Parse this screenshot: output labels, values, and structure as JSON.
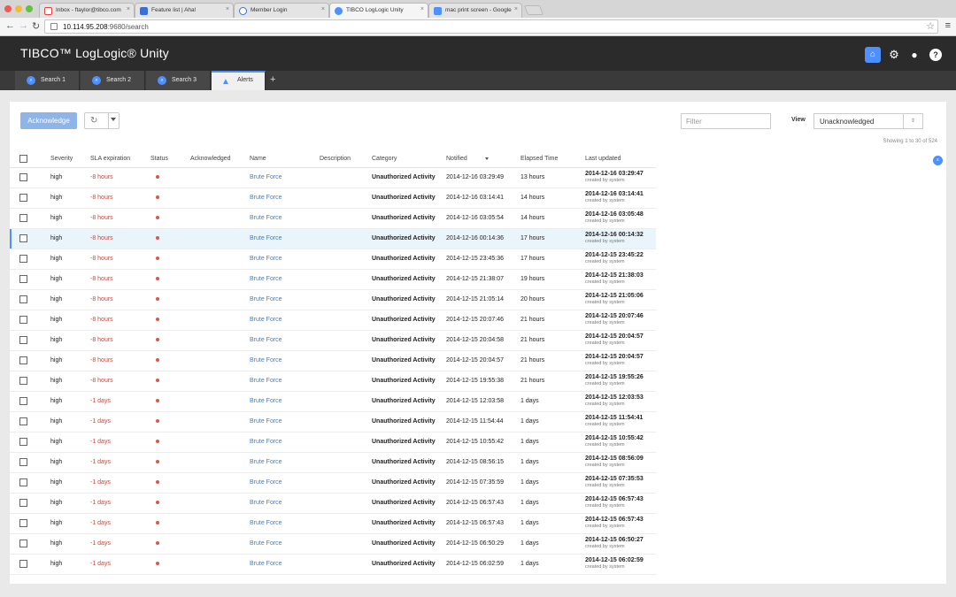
{
  "browser": {
    "tabs": [
      {
        "label": "Inbox - ftaylor@tibco.com"
      },
      {
        "label": "Feature list | Aha!"
      },
      {
        "label": "Member Login"
      },
      {
        "label": "TIBCO LogLogic Unity"
      },
      {
        "label": "mac print screen - Google"
      }
    ],
    "url_host": "10.114.95.208",
    "url_path": ":9680/search"
  },
  "app": {
    "logo": "TIBCO™ LogLogic® Unity",
    "tabs": [
      {
        "label": "Search 1"
      },
      {
        "label": "Search 2"
      },
      {
        "label": "Search 3"
      },
      {
        "label": "Alerts"
      }
    ],
    "add_tab": "+"
  },
  "toolbar": {
    "acknowledge": "Acknowledge",
    "filter_placeholder": "Filter",
    "view_label": "View",
    "view_value": "Unacknowledged",
    "showing": "Showing 1 to 30 of 524"
  },
  "table": {
    "headers": {
      "severity": "Severity",
      "sla": "SLA expiration",
      "status": "Status",
      "ack": "Acknowledged",
      "name": "Name",
      "desc": "Description",
      "category": "Category",
      "notified": "Notified",
      "elapsed": "Elapsed Time",
      "updated": "Last updated"
    },
    "rows": [
      {
        "severity": "high",
        "sla": "-8 hours",
        "name": "Brute Force",
        "category": "Unauthorized Activity",
        "notified": "2014-12-16 03:29:49",
        "elapsed": "13 hours",
        "updated": "2014-12-16 03:29:47",
        "by": "created by system"
      },
      {
        "severity": "high",
        "sla": "-8 hours",
        "name": "Brute Force",
        "category": "Unauthorized Activity",
        "notified": "2014-12-16 03:14:41",
        "elapsed": "14 hours",
        "updated": "2014-12-16 03:14:41",
        "by": "created by system"
      },
      {
        "severity": "high",
        "sla": "-8 hours",
        "name": "Brute Force",
        "category": "Unauthorized Activity",
        "notified": "2014-12-16 03:05:54",
        "elapsed": "14 hours",
        "updated": "2014-12-16 03:05:48",
        "by": "created by system"
      },
      {
        "severity": "high",
        "sla": "-8 hours",
        "name": "Brute Force",
        "category": "Unauthorized Activity",
        "notified": "2014-12-16 00:14:36",
        "elapsed": "17 hours",
        "updated": "2014-12-16 00:14:32",
        "by": "created by system"
      },
      {
        "severity": "high",
        "sla": "-8 hours",
        "name": "Brute Force",
        "category": "Unauthorized Activity",
        "notified": "2014-12-15 23:45:36",
        "elapsed": "17 hours",
        "updated": "2014-12-15 23:45:22",
        "by": "created by system"
      },
      {
        "severity": "high",
        "sla": "-8 hours",
        "name": "Brute Force",
        "category": "Unauthorized Activity",
        "notified": "2014-12-15 21:38:07",
        "elapsed": "19 hours",
        "updated": "2014-12-15 21:38:03",
        "by": "created by system"
      },
      {
        "severity": "high",
        "sla": "-8 hours",
        "name": "Brute Force",
        "category": "Unauthorized Activity",
        "notified": "2014-12-15 21:05:14",
        "elapsed": "20 hours",
        "updated": "2014-12-15 21:05:06",
        "by": "created by system"
      },
      {
        "severity": "high",
        "sla": "-8 hours",
        "name": "Brute Force",
        "category": "Unauthorized Activity",
        "notified": "2014-12-15 20:07:46",
        "elapsed": "21 hours",
        "updated": "2014-12-15 20:07:46",
        "by": "created by system"
      },
      {
        "severity": "high",
        "sla": "-8 hours",
        "name": "Brute Force",
        "category": "Unauthorized Activity",
        "notified": "2014-12-15 20:04:58",
        "elapsed": "21 hours",
        "updated": "2014-12-15 20:04:57",
        "by": "created by system"
      },
      {
        "severity": "high",
        "sla": "-8 hours",
        "name": "Brute Force",
        "category": "Unauthorized Activity",
        "notified": "2014-12-15 20:04:57",
        "elapsed": "21 hours",
        "updated": "2014-12-15 20:04:57",
        "by": "created by system"
      },
      {
        "severity": "high",
        "sla": "-8 hours",
        "name": "Brute Force",
        "category": "Unauthorized Activity",
        "notified": "2014-12-15 19:55:38",
        "elapsed": "21 hours",
        "updated": "2014-12-15 19:55:26",
        "by": "created by system"
      },
      {
        "severity": "high",
        "sla": "-1 days",
        "name": "Brute Force",
        "category": "Unauthorized Activity",
        "notified": "2014-12-15 12:03:58",
        "elapsed": "1 days",
        "updated": "2014-12-15 12:03:53",
        "by": "created by system"
      },
      {
        "severity": "high",
        "sla": "-1 days",
        "name": "Brute Force",
        "category": "Unauthorized Activity",
        "notified": "2014-12-15 11:54:44",
        "elapsed": "1 days",
        "updated": "2014-12-15 11:54:41",
        "by": "created by system"
      },
      {
        "severity": "high",
        "sla": "-1 days",
        "name": "Brute Force",
        "category": "Unauthorized Activity",
        "notified": "2014-12-15 10:55:42",
        "elapsed": "1 days",
        "updated": "2014-12-15 10:55:42",
        "by": "created by system"
      },
      {
        "severity": "high",
        "sla": "-1 days",
        "name": "Brute Force",
        "category": "Unauthorized Activity",
        "notified": "2014-12-15 08:56:15",
        "elapsed": "1 days",
        "updated": "2014-12-15 08:56:09",
        "by": "created by system"
      },
      {
        "severity": "high",
        "sla": "-1 days",
        "name": "Brute Force",
        "category": "Unauthorized Activity",
        "notified": "2014-12-15 07:35:59",
        "elapsed": "1 days",
        "updated": "2014-12-15 07:35:53",
        "by": "created by system"
      },
      {
        "severity": "high",
        "sla": "-1 days",
        "name": "Brute Force",
        "category": "Unauthorized Activity",
        "notified": "2014-12-15 06:57:43",
        "elapsed": "1 days",
        "updated": "2014-12-15 06:57:43",
        "by": "created by system"
      },
      {
        "severity": "high",
        "sla": "-1 days",
        "name": "Brute Force",
        "category": "Unauthorized Activity",
        "notified": "2014-12-15 06:57:43",
        "elapsed": "1 days",
        "updated": "2014-12-15 06:57:43",
        "by": "created by system"
      },
      {
        "severity": "high",
        "sla": "-1 days",
        "name": "Brute Force",
        "category": "Unauthorized Activity",
        "notified": "2014-12-15 06:50:29",
        "elapsed": "1 days",
        "updated": "2014-12-15 06:50:27",
        "by": "created by system"
      },
      {
        "severity": "high",
        "sla": "-1 days",
        "name": "Brute Force",
        "category": "Unauthorized Activity",
        "notified": "2014-12-15 06:02:59",
        "elapsed": "1 days",
        "updated": "2014-12-15 06:02:59",
        "by": "created by system"
      }
    ]
  }
}
